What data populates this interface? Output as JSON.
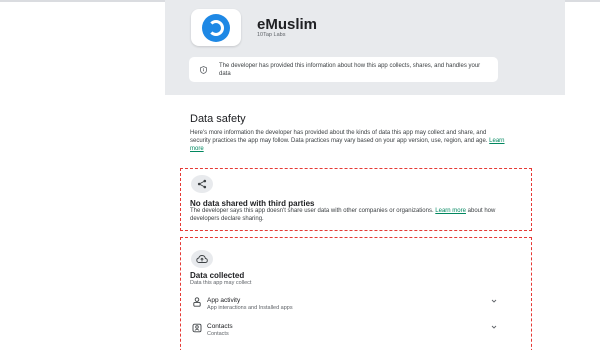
{
  "app": {
    "name": "eMuslim",
    "developer": "10Tap Labs",
    "info_notice": "The developer has provided this information about how this app collects, shares, and handles your data"
  },
  "safety": {
    "title": "Data safety",
    "description": "Here's more information the developer has provided about the kinds of data this app may collect and share, and security practices the app may follow. Data practices may vary based on your app version, use, region, and age.",
    "learn_more": "Learn more"
  },
  "sharing": {
    "title": "No data shared with third parties",
    "description_before": "The developer says this app doesn't share user data with other companies or organizations.",
    "learn_more": "Learn more",
    "description_after": "about how developers declare sharing."
  },
  "collected": {
    "title": "Data collected",
    "subtitle": "Data this app may collect",
    "items": [
      {
        "label": "App activity",
        "sublabel": "App interactions and Installed apps",
        "icon": "app-activity-icon"
      },
      {
        "label": "Contacts",
        "sublabel": "Contacts",
        "icon": "contacts-icon"
      }
    ]
  },
  "colors": {
    "accent_link": "#01875f",
    "app_logo": "#1e88e5",
    "highlight_border": "#e53935",
    "header_bg": "#e8eaed"
  }
}
